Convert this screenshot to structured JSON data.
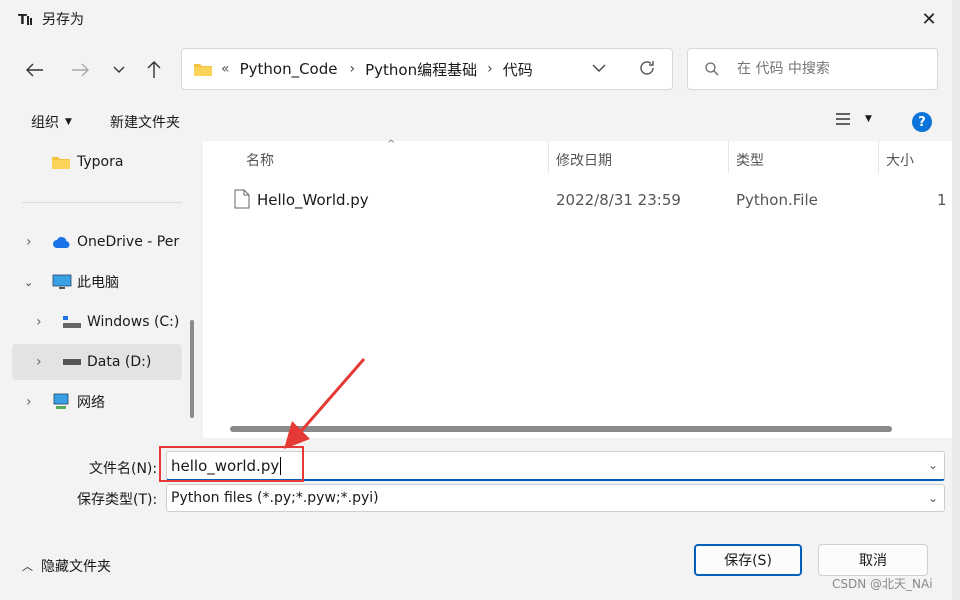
{
  "window": {
    "title": "另存为",
    "close_icon": "close-icon"
  },
  "address": {
    "overflow": "«",
    "crumbs": [
      "Python_Code",
      "Python编程基础",
      "代码"
    ]
  },
  "search": {
    "placeholder": "在 代码 中搜索"
  },
  "toolbar": {
    "organize": "组织",
    "new_folder": "新建文件夹"
  },
  "nav": {
    "items": [
      {
        "label": "Typora",
        "icon": "folder-icon"
      },
      {
        "label": "OneDrive - Per",
        "icon": "cloud-icon"
      },
      {
        "label": "此电脑",
        "icon": "computer-icon"
      },
      {
        "label": "Windows (C:)",
        "icon": "drive-icon"
      },
      {
        "label": "Data (D:)",
        "icon": "drive-icon",
        "selected": true
      },
      {
        "label": "网络",
        "icon": "network-icon"
      }
    ]
  },
  "columns": {
    "name": "名称",
    "modified": "修改日期",
    "type": "类型",
    "size": "大小"
  },
  "files": [
    {
      "name": "Hello_World.py",
      "modified": "2022/8/31 23:59",
      "type": "Python.File",
      "size": "1"
    }
  ],
  "form": {
    "filename_label": "文件名(N):",
    "filename_value": "hello_world.py",
    "filetype_label": "保存类型(T):",
    "filetype_value": "Python files (*.py;*.pyw;*.pyi)"
  },
  "footer": {
    "hide_folders": "隐藏文件夹",
    "save": "保存(S)",
    "cancel": "取消"
  },
  "watermark": "CSDN @北天_NAi",
  "colors": {
    "accent": "#005fb8",
    "annotation": "#e53935"
  }
}
